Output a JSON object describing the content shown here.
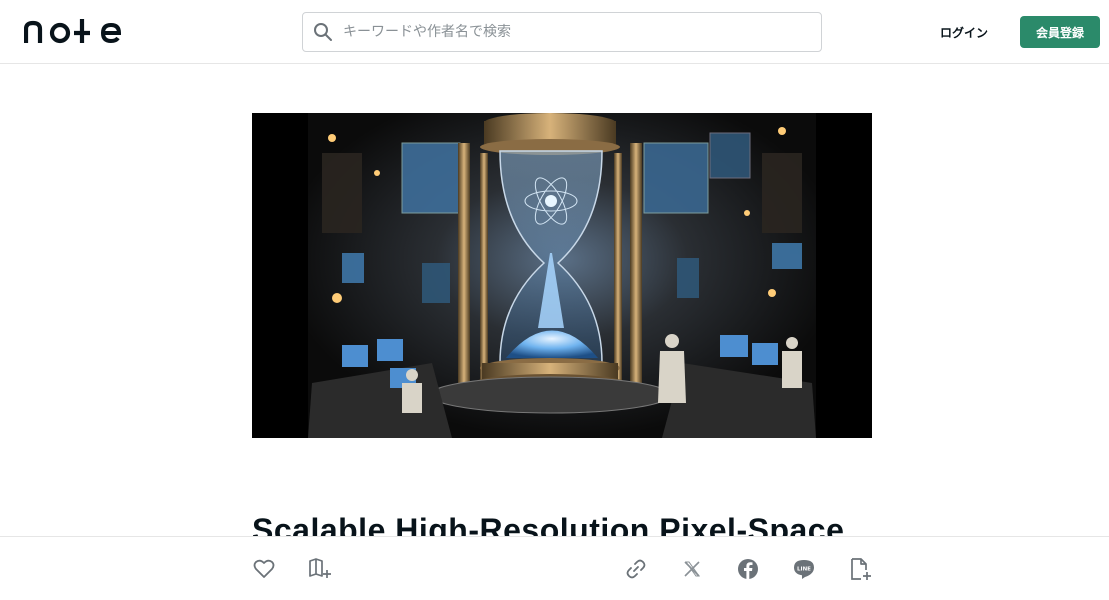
{
  "header": {
    "logo_text": "note",
    "search": {
      "placeholder": "キーワードや作者名で検索",
      "value": ""
    },
    "login_label": "ログイン",
    "signup_label": "会員登録"
  },
  "article": {
    "title": "Scalable High-Resolution Pixel-Space"
  },
  "actions": {
    "like_icon": "heart-icon",
    "save_icon": "magazine-add-icon",
    "share_icons": [
      "link-icon",
      "x-icon",
      "facebook-icon",
      "line-icon",
      "embed-icon"
    ],
    "line_badge": "LINE"
  },
  "colors": {
    "brand_green": "#2b8a6a",
    "text": "#08131a",
    "icon_gray": "#6b7278"
  }
}
